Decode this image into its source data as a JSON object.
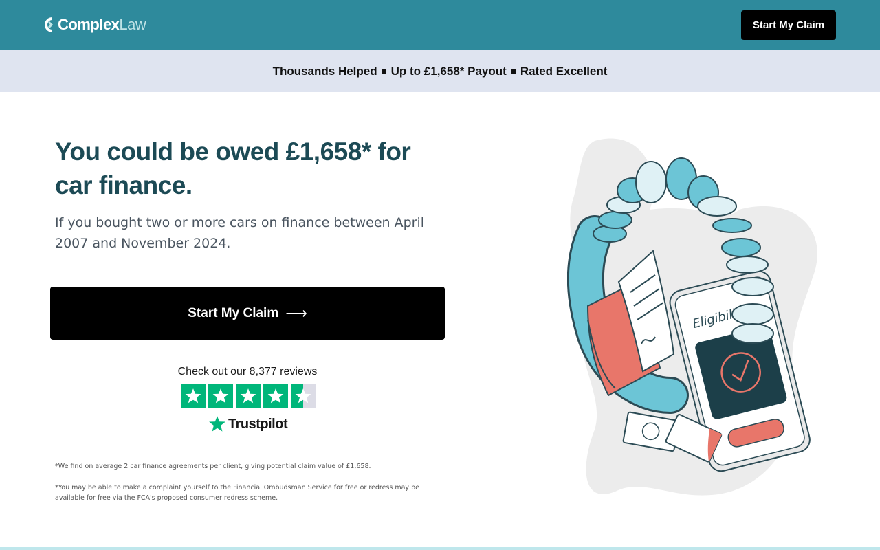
{
  "header": {
    "logo_primary": "Complex",
    "logo_secondary": "Law",
    "cta_label": "Start My Claim"
  },
  "banner": {
    "item1": "Thousands Helped",
    "item2": "Up to £1,658* Payout",
    "item3_prefix": "Rated",
    "item3_link": "Excellent"
  },
  "hero": {
    "title": "You could be owed £1,658* for car finance.",
    "subtitle": "If you bought two or more cars on finance between April 2007 and November 2024.",
    "cta_label": "Start My Claim",
    "cta_arrow": "⟶"
  },
  "reviews": {
    "text": "Check out our 8,377 reviews",
    "rating_stars": 4.5,
    "brand": "Trustpilot"
  },
  "footnotes": {
    "note1": "*We find on average 2 car finance agreements per client, giving potential claim value of £1,658.",
    "note2": "*You may be able to make a complaint yourself to the Financial Ombudsman Service for free or redress may be available for free via the FCA's proposed consumer redress scheme."
  },
  "illustration": {
    "phone_text": "Eligibility"
  },
  "colors": {
    "header_bg": "#2e8a9c",
    "banner_bg": "#dfe4f0",
    "title": "#1c4a55",
    "trustpilot_green": "#00b67a"
  }
}
